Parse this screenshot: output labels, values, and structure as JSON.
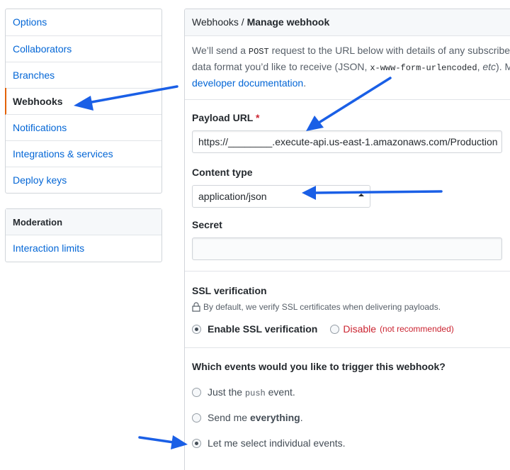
{
  "sidebar": {
    "items": [
      {
        "label": "Options"
      },
      {
        "label": "Collaborators"
      },
      {
        "label": "Branches"
      },
      {
        "label": "Webhooks"
      },
      {
        "label": "Notifications"
      },
      {
        "label": "Integrations & services"
      },
      {
        "label": "Deploy keys"
      }
    ],
    "moderation": {
      "heading": "Moderation",
      "items": [
        {
          "label": "Interaction limits"
        }
      ]
    }
  },
  "header": {
    "crumb": "Webhooks",
    "sep": " / ",
    "title": "Manage webhook"
  },
  "intro": {
    "line1_a": "We’ll send a ",
    "line1_code": "POST",
    "line1_b": " request to the URL below with details of any subscribed",
    "line2_a": "data format you’d like to receive (JSON, ",
    "line2_code": "x-www-form-urlencoded",
    "line2_b": ", ",
    "line2_etc": "etc",
    "line2_c": "). More",
    "link": "developer documentation",
    "line3_end": "."
  },
  "form": {
    "payload_label": "Payload URL",
    "required_mark": "*",
    "payload_value": "https://________.execute-api.us-east-1.amazonaws.com/Production",
    "content_type_label": "Content type",
    "content_type_value": "application/json",
    "secret_label": "Secret",
    "secret_value": ""
  },
  "ssl": {
    "heading": "SSL verification",
    "note": "By default, we verify SSL certificates when delivering payloads.",
    "enable_label": "Enable SSL verification",
    "disable_label": "Disable",
    "disable_note": "(not recommended)"
  },
  "events": {
    "heading": "Which events would you like to trigger this webhook?",
    "opt1_a": "Just the ",
    "opt1_code": "push",
    "opt1_b": " event.",
    "opt2_a": "Send me ",
    "opt2_bold": "everything",
    "opt2_b": ".",
    "opt3": "Let me select individual events.",
    "selected": 3
  },
  "colors": {
    "link": "#0366d6",
    "selected_marker": "#e36209",
    "danger": "#cb2431",
    "annotation_arrow": "#1a5fe6"
  }
}
